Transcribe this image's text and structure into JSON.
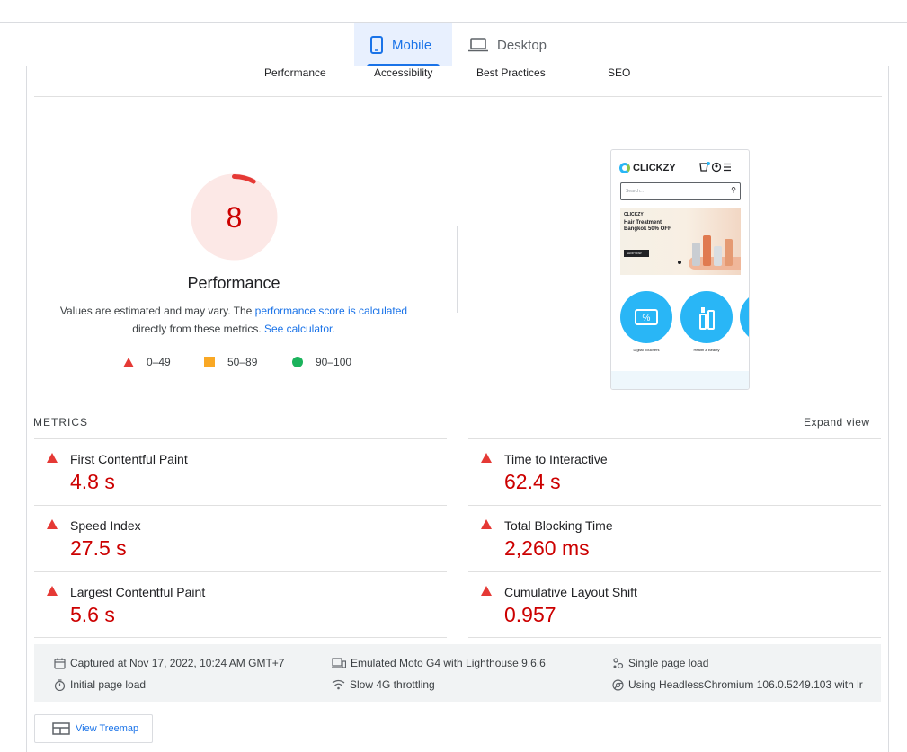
{
  "device_tabs": {
    "mobile": "Mobile",
    "desktop": "Desktop",
    "active": "mobile"
  },
  "categories": [
    "Performance",
    "Accessibility",
    "Best Practices",
    "SEO"
  ],
  "score": {
    "value": "8",
    "fraction": 0.08,
    "title": "Performance",
    "desc_part1": "Values are estimated and may vary. The ",
    "desc_link1": "performance score is calculated",
    "desc_part2": "directly from these metrics. ",
    "desc_link2": "See calculator.",
    "color": "#cc0000",
    "ring_bg": "#fce8e6"
  },
  "legend": [
    {
      "shape": "triangle",
      "color": "#e53935",
      "range": "0–49"
    },
    {
      "shape": "square",
      "color": "#f9a825",
      "range": "50–89"
    },
    {
      "shape": "circle",
      "color": "#1bb35c",
      "range": "90–100"
    }
  ],
  "thumbnail": {
    "brand": "CLICKZY",
    "search_placeholder": "Search...",
    "banner_brand": "CLICKZY",
    "banner_title": "Hair Treatment Bangkok 50% OFF",
    "banner_button": "SHOP NOW",
    "category_1": "Digital Vouchers",
    "category_2": "Health & Beauty"
  },
  "metrics": {
    "header": "METRICS",
    "expand": "Expand view",
    "items": [
      {
        "label": "First Contentful Paint",
        "value": "4.8 s"
      },
      {
        "label": "Time to Interactive",
        "value": "62.4 s"
      },
      {
        "label": "Speed Index",
        "value": "27.5 s"
      },
      {
        "label": "Total Blocking Time",
        "value": "2,260 ms"
      },
      {
        "label": "Largest Contentful Paint",
        "value": "5.6 s"
      },
      {
        "label": "Cumulative Layout Shift",
        "value": "0.957"
      }
    ]
  },
  "info": {
    "captured": "Captured at Nov 17, 2022, 10:24 AM GMT+7",
    "emulated": "Emulated Moto G4 with Lighthouse 9.6.6",
    "single_load": "Single page load",
    "initial_load": "Initial page load",
    "throttling": "Slow 4G throttling",
    "browser": "Using HeadlessChromium 106.0.5249.103 with lr"
  },
  "treemap_label": "View Treemap"
}
